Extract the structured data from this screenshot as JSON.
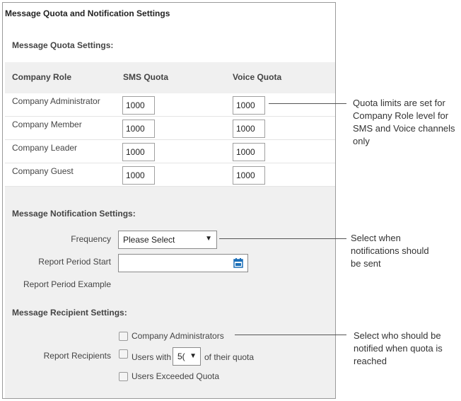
{
  "panel": {
    "title": "Message Quota and Notification Settings"
  },
  "quota": {
    "section_title": "Message Quota Settings:",
    "headers": [
      "Company Role",
      "SMS Quota",
      "Voice Quota"
    ],
    "rows": [
      {
        "role": "Company Administrator",
        "sms": "1000",
        "voice": "1000"
      },
      {
        "role": "Company Member",
        "sms": "1000",
        "voice": "1000"
      },
      {
        "role": "Company Leader",
        "sms": "1000",
        "voice": "1000"
      },
      {
        "role": "Company Guest",
        "sms": "1000",
        "voice": "1000"
      }
    ]
  },
  "notification": {
    "section_title": "Message Notification Settings:",
    "frequency_label": "Frequency",
    "frequency_value": "Please Select",
    "report_start_label": "Report Period Start",
    "report_start_value": "",
    "report_example_label": "Report Period Example"
  },
  "recipients": {
    "section_title": "Message Recipient Settings:",
    "label": "Report Recipients",
    "options": {
      "admins": "Company Administrators",
      "users_with": "Users with",
      "threshold": "5(",
      "of_quota": "of their quota",
      "exceeded": "Users Exceeded Quota"
    }
  },
  "callouts": {
    "quota": [
      "Quota limits are set for",
      "Company Role level for",
      "SMS and Voice channels",
      "only"
    ],
    "frequency": [
      "Select when",
      "notifications should",
      "be sent"
    ],
    "recipients": [
      "Select who should be",
      "notified when quota is",
      "reached"
    ]
  },
  "colors": {
    "accent": "#1b6fb8",
    "header_bg": "#f0f0f0"
  },
  "icons": {
    "calendar": "calendar-icon",
    "dropdown": "chevron-down-icon"
  }
}
